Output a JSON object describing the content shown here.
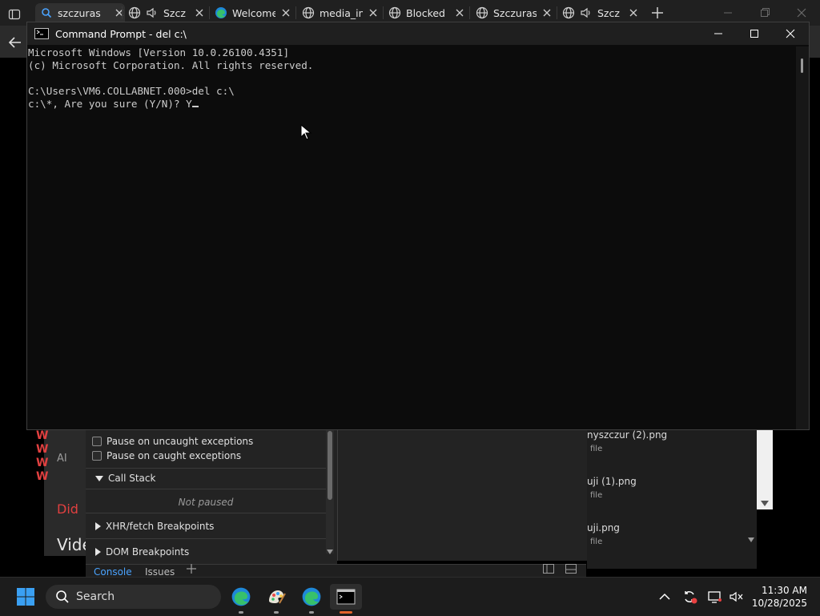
{
  "browser": {
    "tabs": [
      {
        "title": "szczuras",
        "icon": "search-icon",
        "active": true
      },
      {
        "title": "Szcz",
        "icon": "globe-icon",
        "audio": true
      },
      {
        "title": "Welcome",
        "icon": "edge-icon"
      },
      {
        "title": "media_in",
        "icon": "globe-icon"
      },
      {
        "title": "Blocked",
        "icon": "globe-icon"
      },
      {
        "title": "Szczuras",
        "icon": "globe-icon"
      },
      {
        "title": "Szcz",
        "icon": "globe-icon",
        "audio": true
      }
    ]
  },
  "devtools": {
    "pause_uncaught": "Pause on uncaught exceptions",
    "pause_caught": "Pause on caught exceptions",
    "call_stack": "Call Stack",
    "not_paused": "Not paused",
    "xhr_breakpoints": "XHR/fetch Breakpoints",
    "dom_breakpoints": "DOM Breakpoints",
    "tab_console": "Console",
    "tab_issues": "Issues"
  },
  "page_fragments": {
    "ai": "AI",
    "did": "Did",
    "video": "Vide"
  },
  "files": [
    {
      "name": "nyszczur (2).png",
      "meta": "file"
    },
    {
      "name": "uji (1).png",
      "meta": "file"
    },
    {
      "name": "uji.png",
      "meta": "file"
    }
  ],
  "cmd": {
    "title": "Command Prompt - del  c:\\",
    "lines": [
      "Microsoft Windows [Version 10.0.26100.4351]",
      "(c) Microsoft Corporation. All rights reserved.",
      "",
      "C:\\Users\\VM6.COLLABNET.000>del c:\\",
      "c:\\*, Are you sure (Y/N)? Y"
    ]
  },
  "taskbar": {
    "search_label": "Search",
    "time": "11:30 AM",
    "date": "10/28/2025"
  }
}
